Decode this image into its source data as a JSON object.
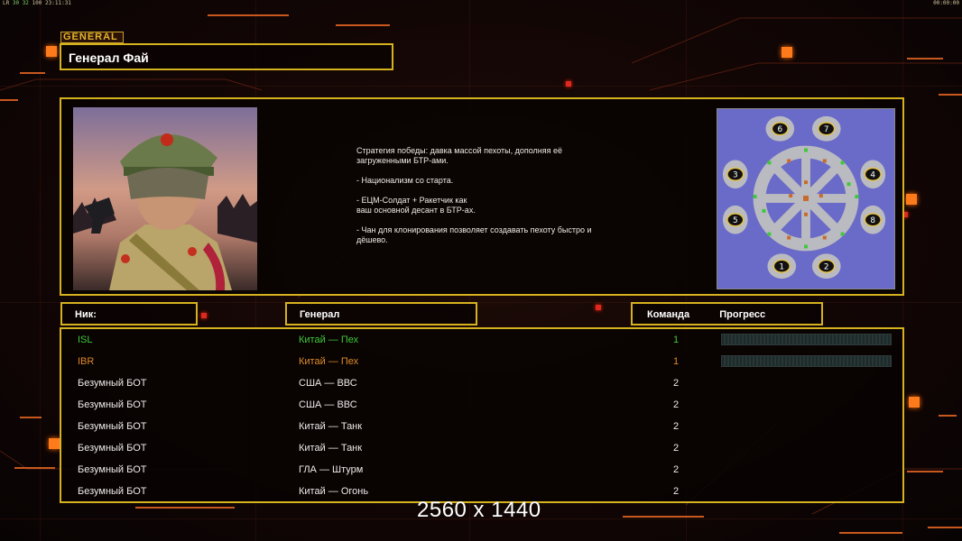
{
  "status": {
    "left_prefix": "LR",
    "fps": "30 32",
    "counter": "100",
    "time": "23:11:31",
    "right_time": "00:00:00"
  },
  "general": {
    "tag": "GENERAL",
    "name": "Генерал Фай",
    "description": [
      "Стратегия победы: давка массой пехоты, дополняя её\n загруженными БТР-ами.",
      "- Национализм со старта.",
      "- ЕЦМ-Солдат + Ракетчик как\nваш основной десант в БТР-ах.",
      "- Чан для клонирования позволяет создавать пехоту быстро и\n дёшево."
    ]
  },
  "minimap": {
    "background": "#6a6ac8",
    "start_positions": [
      "6",
      "7",
      "3",
      "4",
      "5",
      "8",
      "1",
      "2"
    ]
  },
  "table": {
    "headers": {
      "nick": "Ник:",
      "general": "Генерал",
      "team": "Команда",
      "progress": "Прогресс"
    },
    "rows": [
      {
        "nick": "ISL",
        "general": "Китай — Пех",
        "team": "1",
        "color": "green",
        "progress_bar": true
      },
      {
        "nick": "IBR",
        "general": "Китай — Пех",
        "team": "1",
        "color": "orange",
        "progress_bar": true
      },
      {
        "nick": "Безумный БОТ",
        "general": "США — ВВС",
        "team": "2",
        "color": "white",
        "progress_bar": false
      },
      {
        "nick": "Безумный БОТ",
        "general": "США — ВВС",
        "team": "2",
        "color": "white",
        "progress_bar": false
      },
      {
        "nick": "Безумный БОТ",
        "general": "Китай — Танк",
        "team": "2",
        "color": "white",
        "progress_bar": false
      },
      {
        "nick": "Безумный БОТ",
        "general": "Китай — Танк",
        "team": "2",
        "color": "white",
        "progress_bar": false
      },
      {
        "nick": "Безумный БОТ",
        "general": "ГЛА — Штурм",
        "team": "2",
        "color": "white",
        "progress_bar": false
      },
      {
        "nick": "Безумный БОТ",
        "general": "Китай — Огонь",
        "team": "2",
        "color": "white",
        "progress_bar": false
      }
    ]
  },
  "watermark": "2560 x 1440",
  "colors": {
    "frame": "#d6b21f",
    "accent": "#ff7a1a",
    "player_green": "#3fc83a",
    "player_orange": "#e08a2a"
  }
}
